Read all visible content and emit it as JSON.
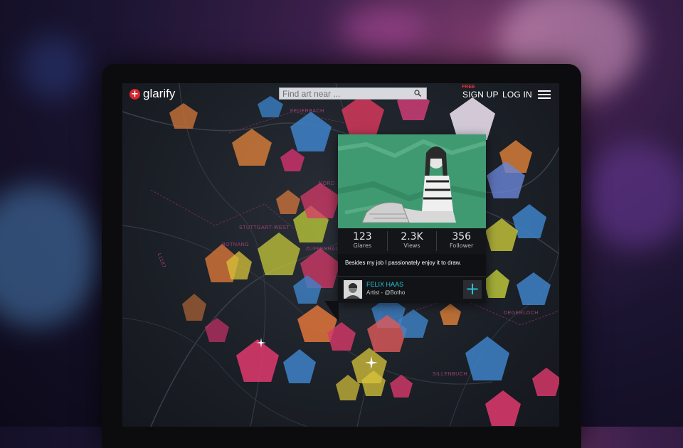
{
  "app": {
    "brand": "glarify",
    "logo_icon": "+",
    "accent_color": "#d8282d",
    "highlight_color": "#27c2d4"
  },
  "header": {
    "search_placeholder": "Find art near ...",
    "search_icon": "search-icon",
    "free_badge": "FREE",
    "signup_label": "SIGN UP",
    "login_label": "LOG IN",
    "menu_icon": "hamburger-menu-icon"
  },
  "map": {
    "labels": [
      "FEUERBACH",
      "NORD",
      "STUTTGART-WEST",
      "BOTNANG",
      "L1187",
      "ZUFFENHAUSEN",
      "SILLENBUCH",
      "DEGERLOCH"
    ]
  },
  "card": {
    "stats": [
      {
        "value": "123",
        "label": "Glares"
      },
      {
        "value": "2.3K",
        "label": "Views"
      },
      {
        "value": "356",
        "label": "Follower"
      }
    ],
    "bio": "Besides my job I passionately enjoy it to draw.",
    "artist_name": "FELIX HAAS",
    "artist_role": "Artist - @Botho",
    "follow_label": "+"
  }
}
